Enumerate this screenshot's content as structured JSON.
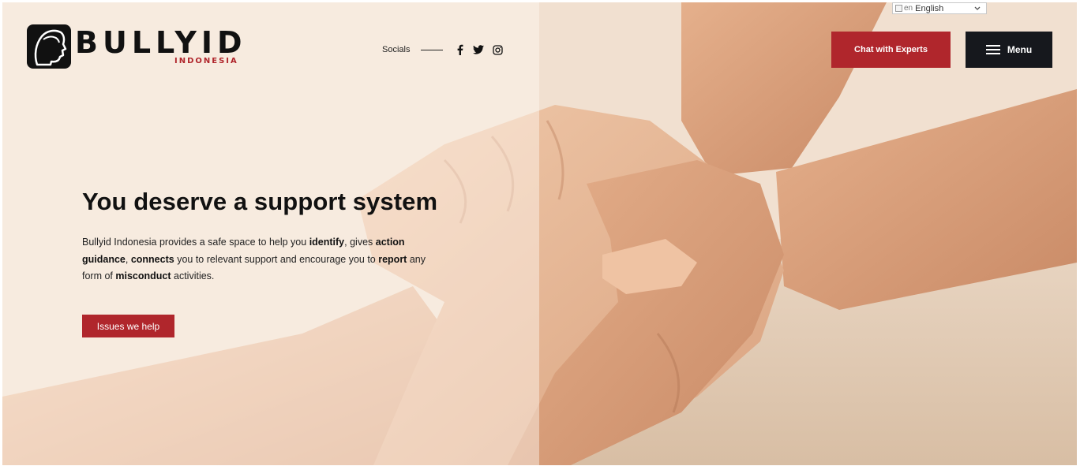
{
  "brand": {
    "name": "BULLYID",
    "subname": "INDONESIA",
    "accent_color": "#b0262c",
    "dark_color": "#16181d"
  },
  "language": {
    "flag_alt": "en",
    "selected": "English"
  },
  "socials": {
    "label": "Socials",
    "icons": [
      "facebook-icon",
      "twitter-icon",
      "instagram-icon"
    ]
  },
  "header": {
    "chat_label": "Chat with Experts",
    "menu_label": "Menu"
  },
  "hero": {
    "title": "You deserve a support system",
    "desc": {
      "p1": "Bullyid Indonesia provides a safe space to help you ",
      "b1": "identify",
      "p2": ", gives ",
      "b2": "action guidance",
      "p3": ", ",
      "b3": "connects",
      "p4": " you to relevant support and encourage you to ",
      "b4": "report",
      "p5": " any form of ",
      "b5": "misconduct",
      "p6": " activities."
    },
    "cta_label": "Issues we help"
  }
}
